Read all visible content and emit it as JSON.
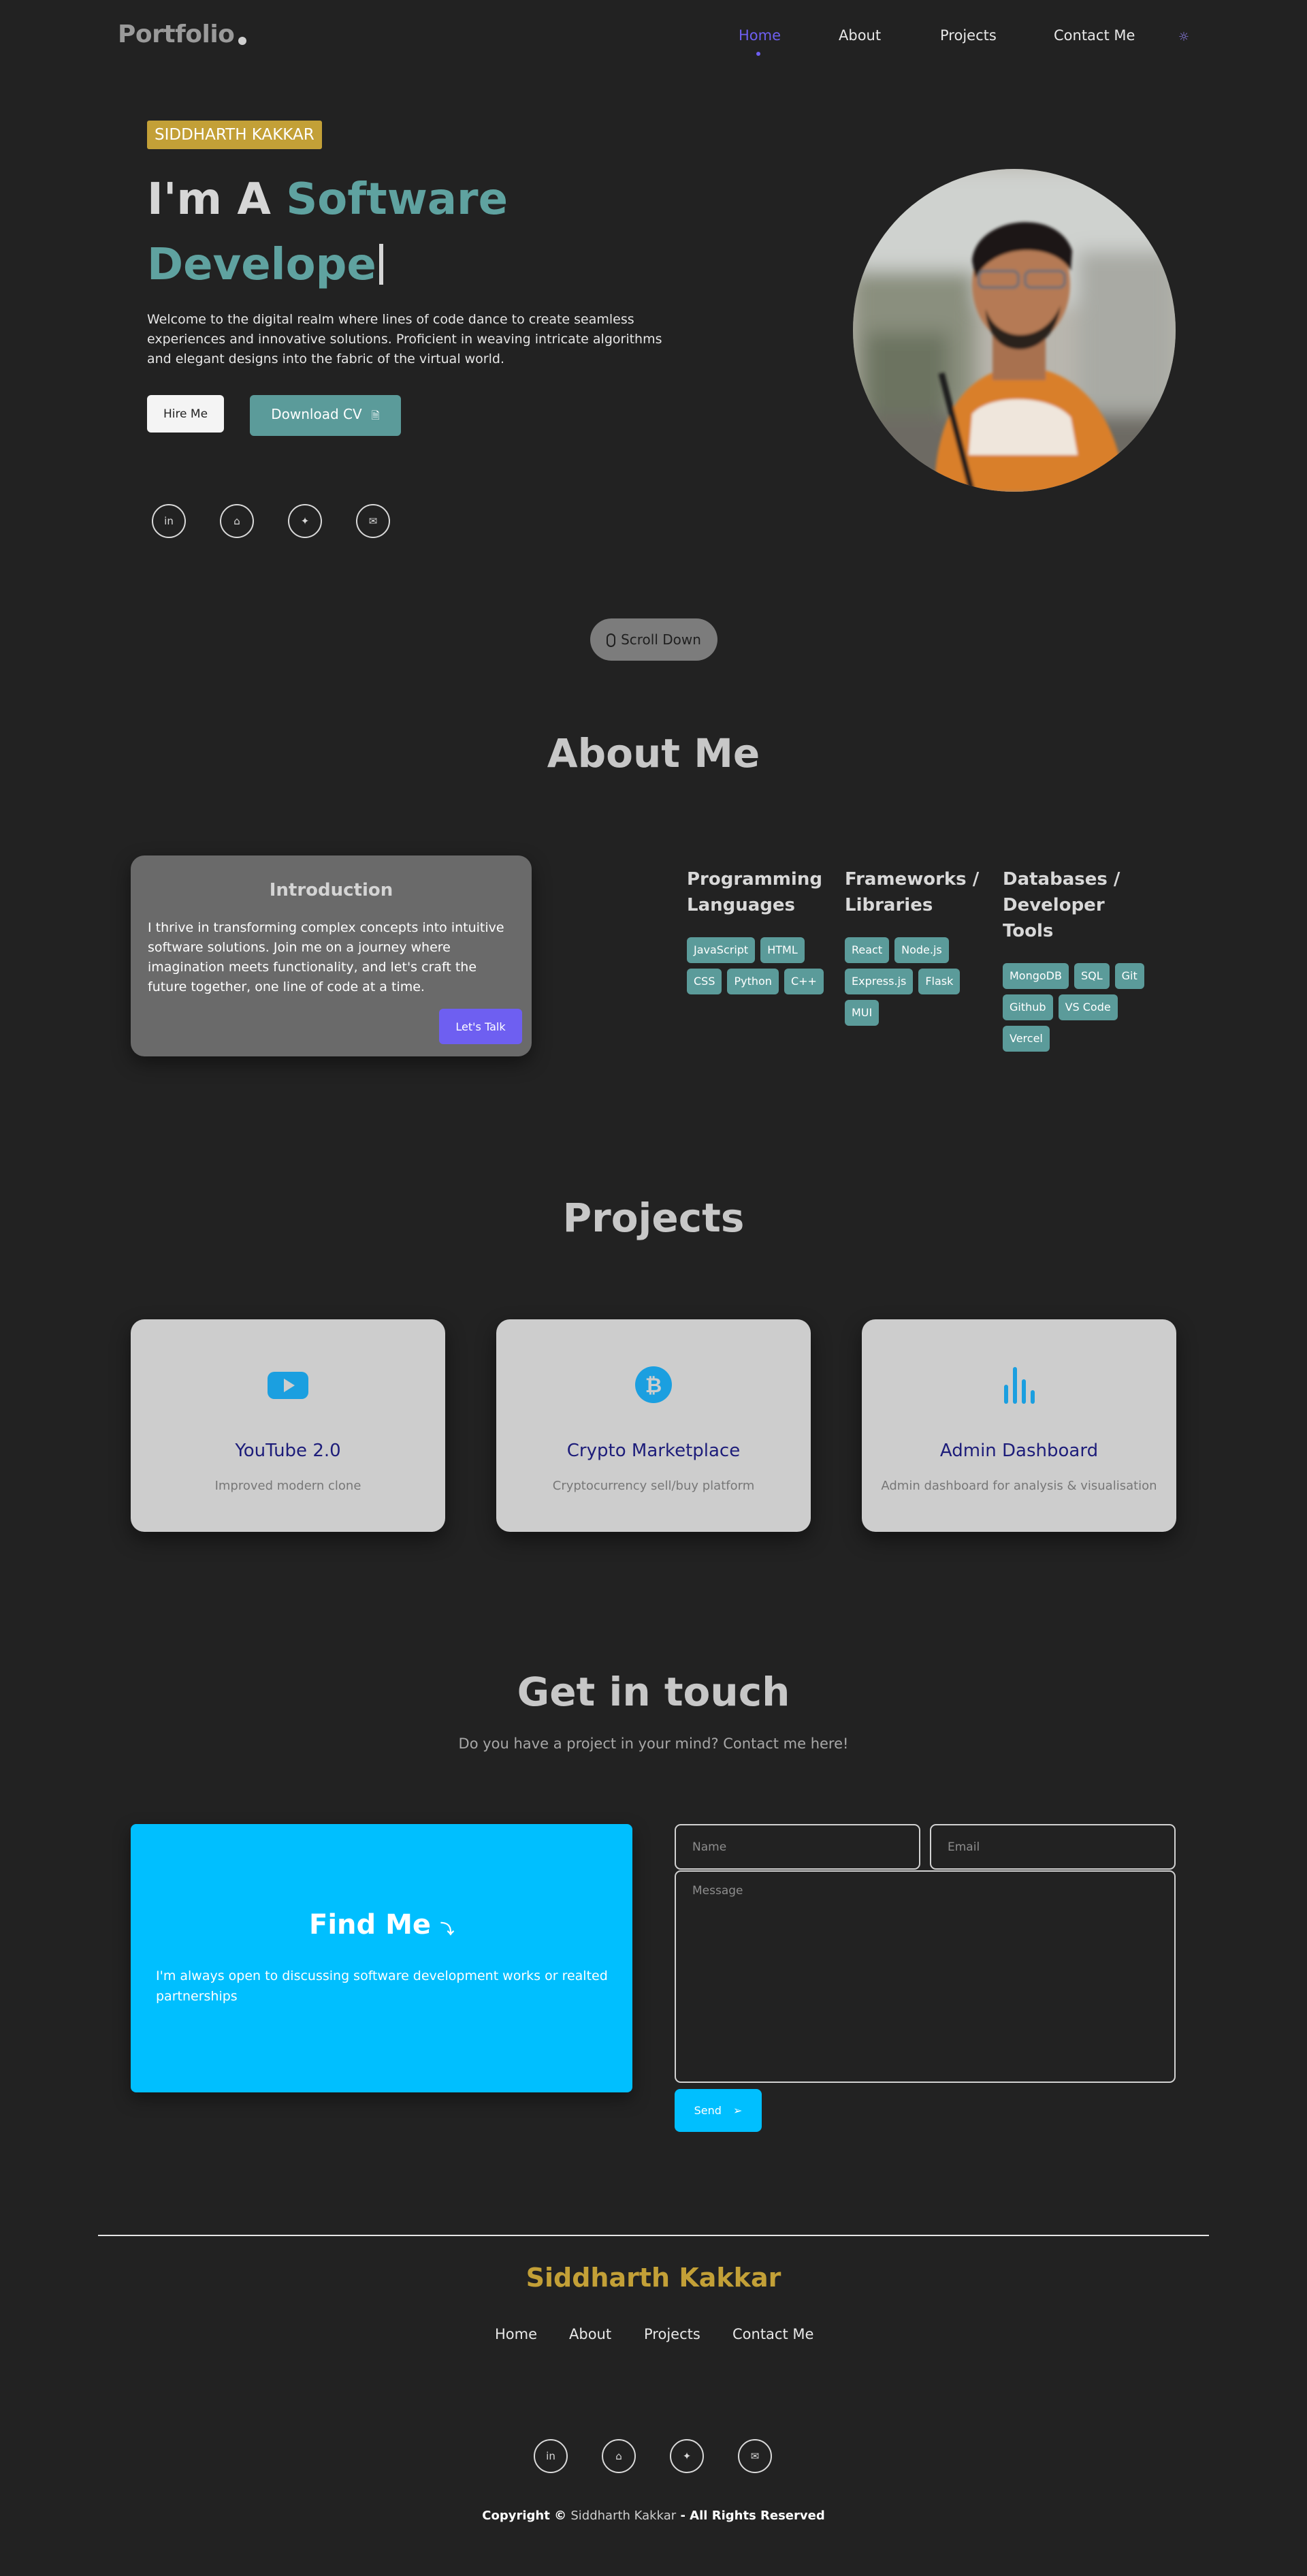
{
  "nav": {
    "logo": "Portfolio",
    "links": [
      {
        "label": "Home",
        "active": true
      },
      {
        "label": "About",
        "active": false
      },
      {
        "label": "Projects",
        "active": false
      },
      {
        "label": "Contact Me",
        "active": false
      }
    ],
    "theme_icon": "sun-icon"
  },
  "hero": {
    "badge": "SIDDHARTH KAKKAR",
    "title_prefix": "I'm A",
    "title_word_1": "Software",
    "title_word_2": "Develope",
    "description": "Welcome to the digital realm where lines of code dance to create seamless experiences and innovative solutions. Proficient in weaving intricate algorithms and elegant designs into the fabric of the virtual world.",
    "hire_label": "Hire Me",
    "cv_label": "Download CV",
    "socials": [
      "linkedin-icon",
      "github-icon",
      "twitter-icon",
      "mail-icon"
    ],
    "scroll_label": "Scroll Down"
  },
  "about": {
    "title": "About Me",
    "intro_title": "Introduction",
    "intro_text": "I thrive in transforming complex concepts into intuitive software solutions. Join me on a journey where imagination meets functionality, and let's craft the future together, one line of code at a time.",
    "talk_label": "Let's Talk",
    "skills": [
      {
        "heading": "Programming Languages",
        "items": [
          "JavaScript",
          "HTML",
          "CSS",
          "Python",
          "C++"
        ]
      },
      {
        "heading": "Frameworks / Libraries",
        "items": [
          "React",
          "Node.js",
          "Express.js",
          "Flask",
          "MUI"
        ]
      },
      {
        "heading": "Databases / Developer Tools",
        "items": [
          "MongoDB",
          "SQL",
          "Git",
          "Github",
          "VS Code",
          "Vercel"
        ]
      }
    ]
  },
  "projects": {
    "title": "Projects",
    "items": [
      {
        "title": "YouTube 2.0",
        "desc": "Improved modern clone",
        "icon": "youtube-icon"
      },
      {
        "title": "Crypto Marketplace",
        "desc": "Cryptocurrency sell/buy platform",
        "icon": "bitcoin-icon"
      },
      {
        "title": "Admin Dashboard",
        "desc": "Admin dashboard for analysis & visualisation",
        "icon": "bar-chart-icon"
      }
    ]
  },
  "contact": {
    "title": "Get in touch",
    "subtitle": "Do you have a project in your mind? Contact me here!",
    "find_title": "Find Me",
    "find_text": "I'm always open to discussing software development works or realted partnerships",
    "name_placeholder": "Name",
    "email_placeholder": "Email",
    "message_placeholder": "Message",
    "send_label": "Send"
  },
  "footer": {
    "name": "Siddharth Kakkar",
    "links": [
      "Home",
      "About",
      "Projects",
      "Contact Me"
    ],
    "socials": [
      "linkedin-icon",
      "github-icon",
      "twitter-icon",
      "mail-icon"
    ],
    "copyright_prefix": "Copyright ©",
    "copyright_name": "Siddharth Kakkar",
    "copyright_suffix": "- All Rights Reserved"
  },
  "colors": {
    "background": "#222222",
    "accent_purple": "#6e5ff1",
    "accent_teal": "#5b9b9a",
    "accent_gold": "#c3a037",
    "accent_cyan": "#00bfff"
  }
}
